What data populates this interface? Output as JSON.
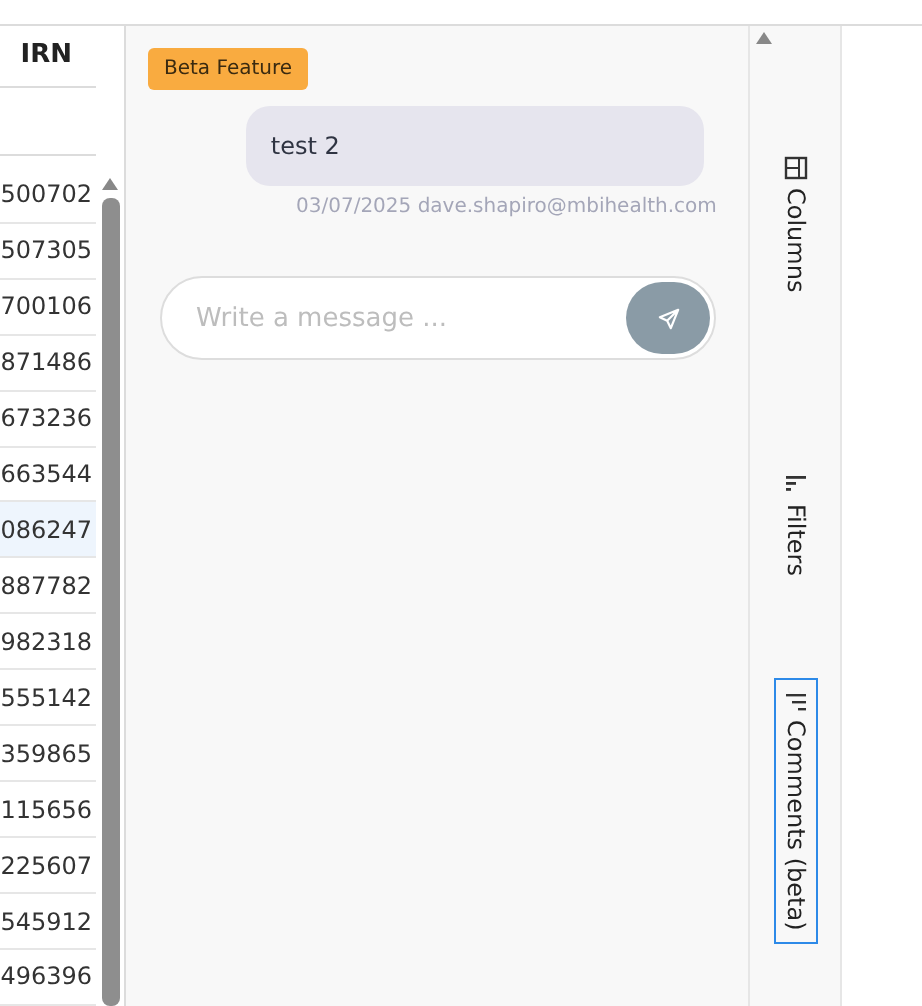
{
  "grid": {
    "column_header": "IRN",
    "rows": [
      {
        "value": "500702",
        "selected": false
      },
      {
        "value": "507305",
        "selected": false
      },
      {
        "value": "700106",
        "selected": false
      },
      {
        "value": "871486",
        "selected": false
      },
      {
        "value": "673236",
        "selected": false
      },
      {
        "value": "663544",
        "selected": false
      },
      {
        "value": "086247",
        "selected": true
      },
      {
        "value": "887782",
        "selected": false
      },
      {
        "value": "982318",
        "selected": false
      },
      {
        "value": "555142",
        "selected": false
      },
      {
        "value": "359865",
        "selected": false
      },
      {
        "value": "115656",
        "selected": false
      },
      {
        "value": "225607",
        "selected": false
      },
      {
        "value": "545912",
        "selected": false
      },
      {
        "value": "496396",
        "selected": false
      }
    ]
  },
  "comments": {
    "badge": "Beta Feature",
    "messages": [
      {
        "text": "test 2",
        "meta": "03/07/2025 dave.shapiro@mbihealth.com"
      }
    ],
    "input": {
      "placeholder": "Write a message ..."
    }
  },
  "side_tabs": [
    {
      "kind": "columns",
      "label": "Columns",
      "selected": false
    },
    {
      "kind": "filters",
      "label": "Filters",
      "selected": false
    },
    {
      "kind": "comments",
      "label": "Comments (beta)",
      "selected": true
    }
  ]
}
